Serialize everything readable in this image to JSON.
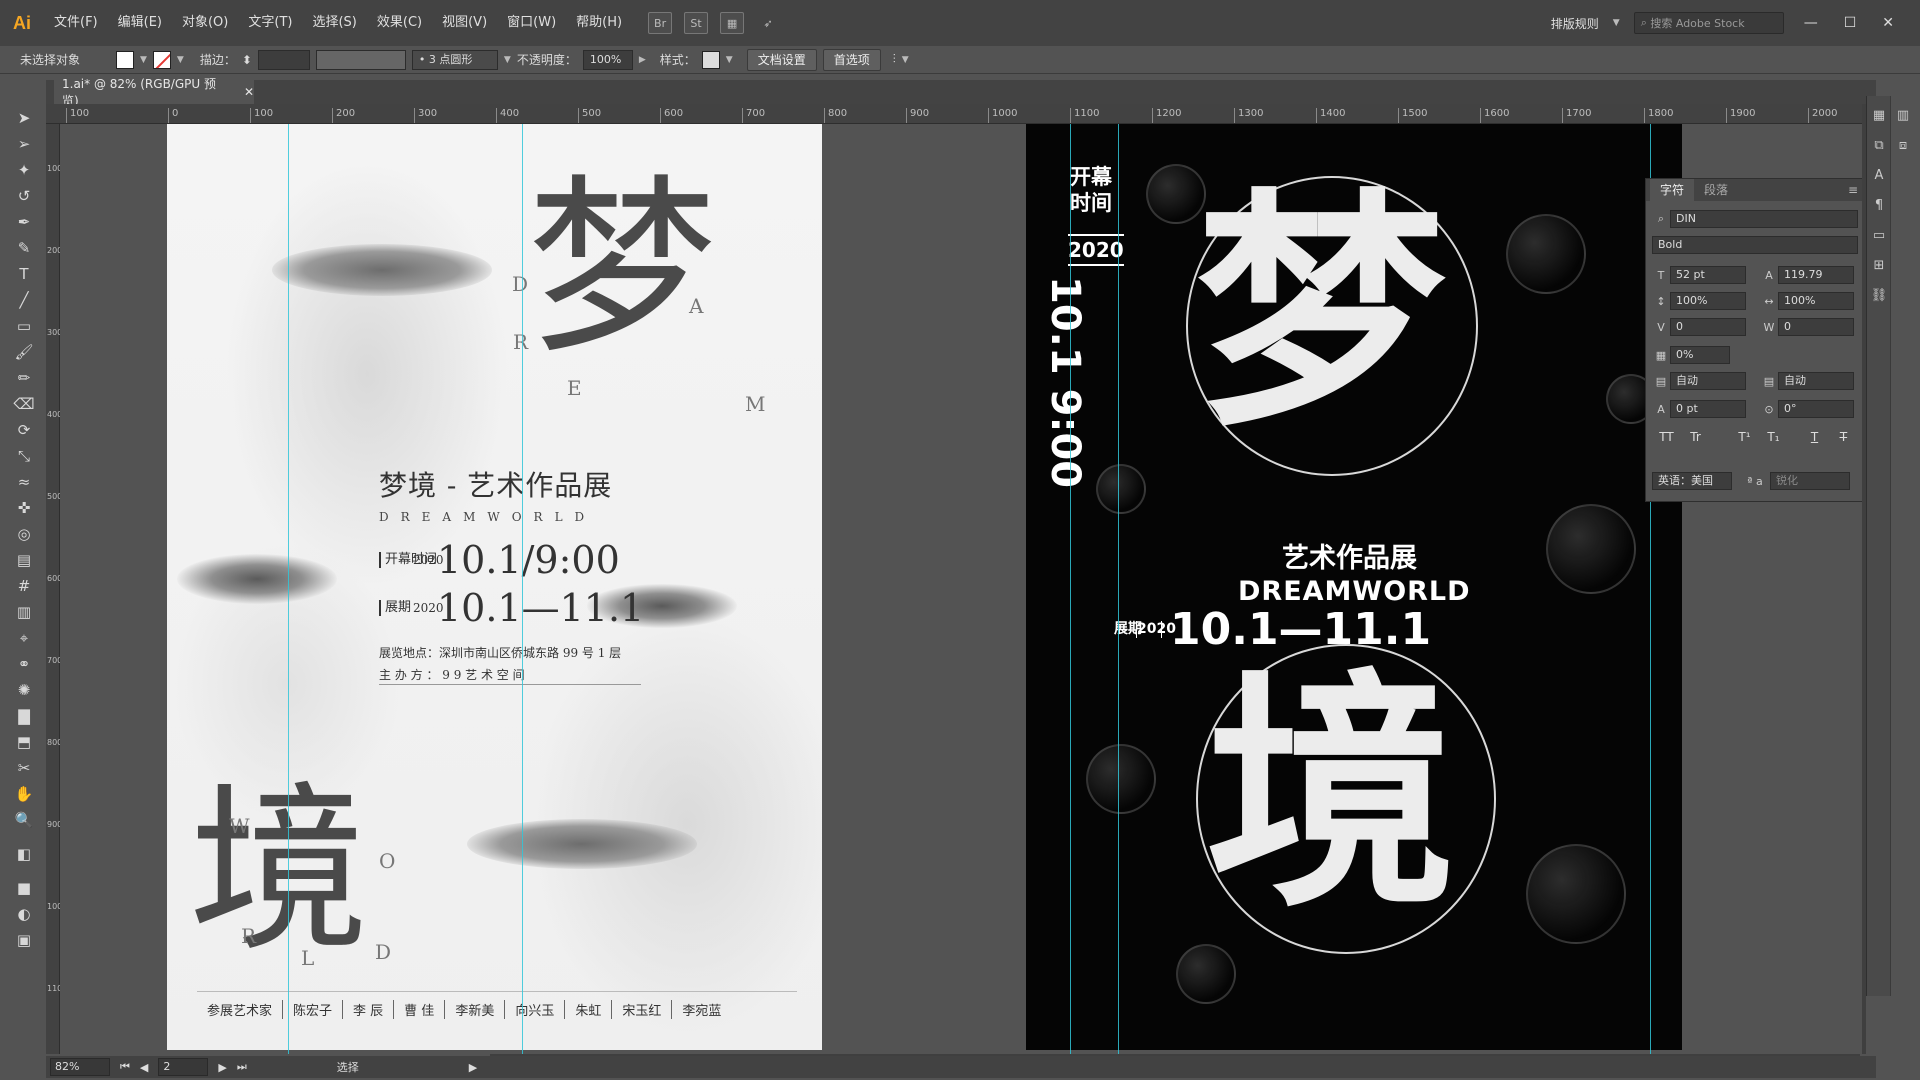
{
  "menubar": {
    "logo": "Ai",
    "items": [
      "文件(F)",
      "编辑(E)",
      "对象(O)",
      "文字(T)",
      "选择(S)",
      "效果(C)",
      "视图(V)",
      "窗口(W)",
      "帮助(H)"
    ],
    "icons": [
      "bridge-icon",
      "stock-icon",
      "arrange-documents-icon",
      "gpu-icon"
    ],
    "workspace": "排版规则",
    "search_placeholder": "搜索 Adobe Stock"
  },
  "controlbar": {
    "selection": "未选择对象",
    "stroke_label": "描边：",
    "brush": "3 点圆形",
    "opacity_label": "不透明度：",
    "opacity_value": "100%",
    "style_label": "样式：",
    "doc_settings": "文档设置",
    "preferences": "首选项"
  },
  "document": {
    "tab": "1.ai* @ 82% (RGB/GPU 预览)"
  },
  "ruler_h": [
    "100",
    "0",
    "100",
    "200",
    "300",
    "400",
    "500",
    "600",
    "700",
    "800",
    "900",
    "1000",
    "1100",
    "1200",
    "1300",
    "1400",
    "1500",
    "1600",
    "1700",
    "1800",
    "1900",
    "2000"
  ],
  "ruler_v": [
    "100",
    "200",
    "300",
    "400",
    "500",
    "600",
    "700",
    "800",
    "900",
    "1000",
    "1100"
  ],
  "poster_light": {
    "char_top": "梦",
    "char_bottom": "境",
    "latin_top": [
      "D",
      "R",
      "E",
      "A",
      "M"
    ],
    "latin_bottom": [
      "W",
      "O",
      "R",
      "L",
      "D"
    ],
    "title": "梦境 - 艺术作品展",
    "subtitle": "DREAMWORLD",
    "open_label": "开幕时间",
    "exhibit_label": "展期",
    "year": "2020",
    "open_date": "10.1/9:00",
    "exhibit_dates": "10.1—11.1",
    "venue": "展览地点：深圳市南山区侨城东路 99 号 1 层",
    "organizer": "主 办 方 ： 9 9 艺 术 空 间",
    "artists": [
      "参展艺术家",
      "陈宏子",
      "李 辰",
      "曹 佳",
      "李新美",
      "向兴玉",
      "朱虹",
      "宋玉红",
      "李宛蓝"
    ]
  },
  "poster_dark": {
    "open_label": "开幕时间",
    "year": "2020",
    "vertical_date": "10.1 9:00",
    "char_top": "梦",
    "char_bottom": "境",
    "exhibit_title": "艺术作品展",
    "dreamworld": "DREAMWORLD",
    "exhibit_label": "展期",
    "exhibit_year": "2020",
    "exhibit_dates": "10.1—11.1"
  },
  "character_panel": {
    "tabs": [
      "字符",
      "段落"
    ],
    "font_family": "DIN",
    "font_style": "Bold",
    "font_size": "52 pt",
    "leading": "119.79",
    "vertical_scale": "100%",
    "horizontal_scale": "100%",
    "kerning": "0",
    "tracking": "0",
    "baseline_shift_pct": "0%",
    "auto_left": "自动",
    "auto_right": "自动",
    "baseline": "0 pt",
    "rotation": "0°",
    "glyphs": [
      "TT",
      "Tr",
      "T¹",
      "T₁",
      "T",
      "T̶"
    ],
    "language": "英语：美国",
    "aa": "ª a",
    "aa_value": "锐化"
  },
  "statusbar": {
    "zoom": "82%",
    "page": "2",
    "tool": "选择"
  }
}
